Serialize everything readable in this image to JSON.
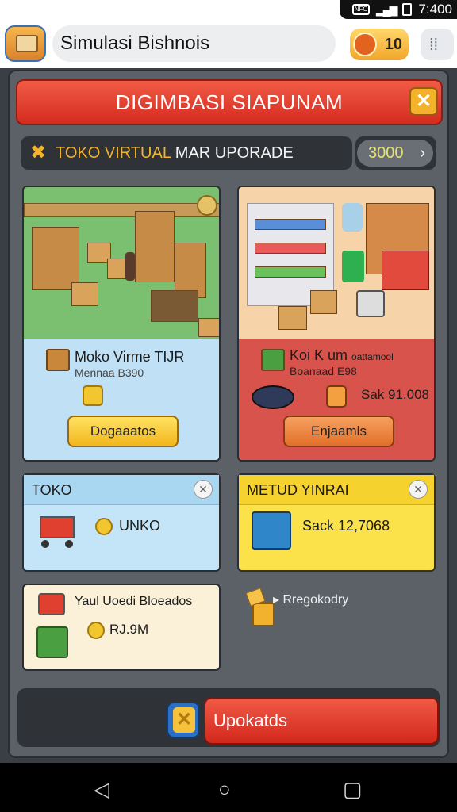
{
  "status_bar": {
    "time": "7:400"
  },
  "top_bar": {
    "title": "Simulasi Bishnois",
    "coins": "10"
  },
  "header": {
    "title": "DIGIMBASI SIAPUNAM"
  },
  "sub_header": {
    "label_accent": "TOKO VIRTUAL",
    "label_rest": " MAR UPORADE",
    "price": "3000",
    "arrow": "›"
  },
  "cards": [
    {
      "title": "Moko Virme TIJR",
      "subtitle": "Mennaa B390",
      "button": "Dogaaatos"
    },
    {
      "title": "Koi K um",
      "title_extra": "oattamool",
      "subtitle": "Boanaad E98",
      "price": "Sak 91.008",
      "button": "Enjaamls"
    }
  ],
  "mid_cards": [
    {
      "header": "TOKO",
      "label": "UNKO"
    },
    {
      "header": "METUD YINRAI",
      "label": "Sack 12,7068"
    }
  ],
  "bottom_left_card": {
    "title": "Yaul Uoedi Bloeados",
    "price": "RJ.9M"
  },
  "bottom_right_note": "Rregokodry",
  "bottom_bar": {
    "update_label": "Upokatds"
  },
  "colors": {
    "accent_red": "#d42c1f",
    "accent_yellow": "#f5b52a",
    "panel": "#5c6168"
  }
}
